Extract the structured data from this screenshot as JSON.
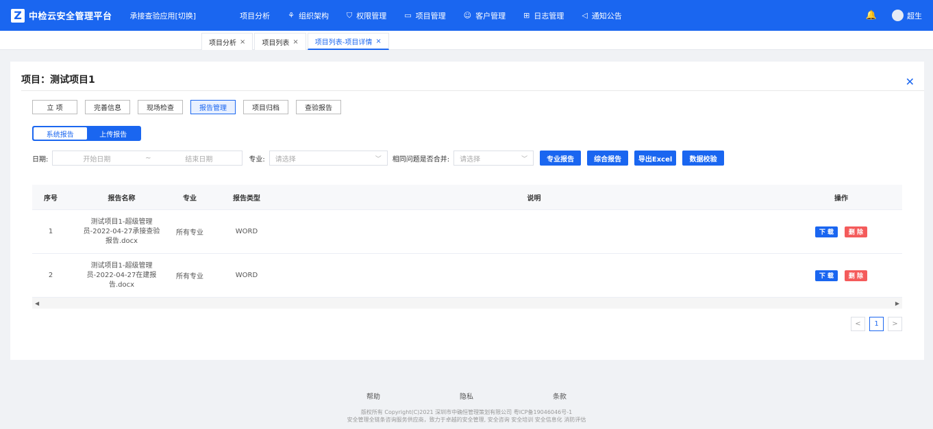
{
  "header": {
    "logo_letter": "Z",
    "app_title": "中检云安全管理平台",
    "app_switch": "承接查验应用[切换]",
    "nav": [
      {
        "icon": "",
        "label": "项目分析"
      },
      {
        "icon": "⚘",
        "label": "组织架构"
      },
      {
        "icon": "⛉",
        "label": "权限管理"
      },
      {
        "icon": "▭",
        "label": "项目管理"
      },
      {
        "icon": "☺",
        "label": "客户管理"
      },
      {
        "icon": "⊞",
        "label": "日志管理"
      },
      {
        "icon": "◁",
        "label": "通知公告"
      }
    ],
    "bell_icon": "🔔",
    "username": "超生"
  },
  "tabs": [
    {
      "label": "项目分析",
      "close": "×"
    },
    {
      "label": "项目列表",
      "close": "×"
    },
    {
      "label": "项目列表-项目详情",
      "close": "×"
    }
  ],
  "card": {
    "title": "项目：测试项目1",
    "close": "✕",
    "steps": [
      "立 项",
      "完善信息",
      "现场检查",
      "报告管理",
      "项目归档",
      "查验报告"
    ],
    "segments": [
      "系统报告",
      "上传报告"
    ],
    "filters": {
      "date_label": "日期:",
      "start_placeholder": "开始日期",
      "sep": "~",
      "end_placeholder": "结束日期",
      "major_label": "专业:",
      "major_placeholder": "请选择",
      "merge_label": "相同问题是否合并:",
      "merge_placeholder": "请选择"
    },
    "actions": [
      "专业报告",
      "综合报告",
      "导出Excel",
      "数据校验"
    ],
    "table": {
      "headers": [
        "序号",
        "报告名称",
        "专业",
        "报告类型",
        "说明",
        "操作"
      ],
      "rows": [
        {
          "no": "1",
          "name": "测试项目1-超级管理员-2022-04-27承接查验报告.docx",
          "major": "所有专业",
          "type": "WORD",
          "desc": ""
        },
        {
          "no": "2",
          "name": "测试项目1-超级管理员-2022-04-27在建报告.docx",
          "major": "所有专业",
          "type": "WORD",
          "desc": ""
        }
      ],
      "download_label": "下 载",
      "delete_label": "删 除"
    },
    "pager": {
      "prev": "<",
      "current": "1",
      "next": ">"
    }
  },
  "footer": {
    "links": [
      "帮助",
      "隐私",
      "条款"
    ],
    "copyright": "版权所有 Copyright(C)2021 深圳市中确恒管理策划有限公司 粤ICP备19046046号-1",
    "tagline": "安全管理全链条咨询服务供应商，致力于卓越的安全管理, 安全咨询 安全培训 安全信息化 消防评估"
  }
}
